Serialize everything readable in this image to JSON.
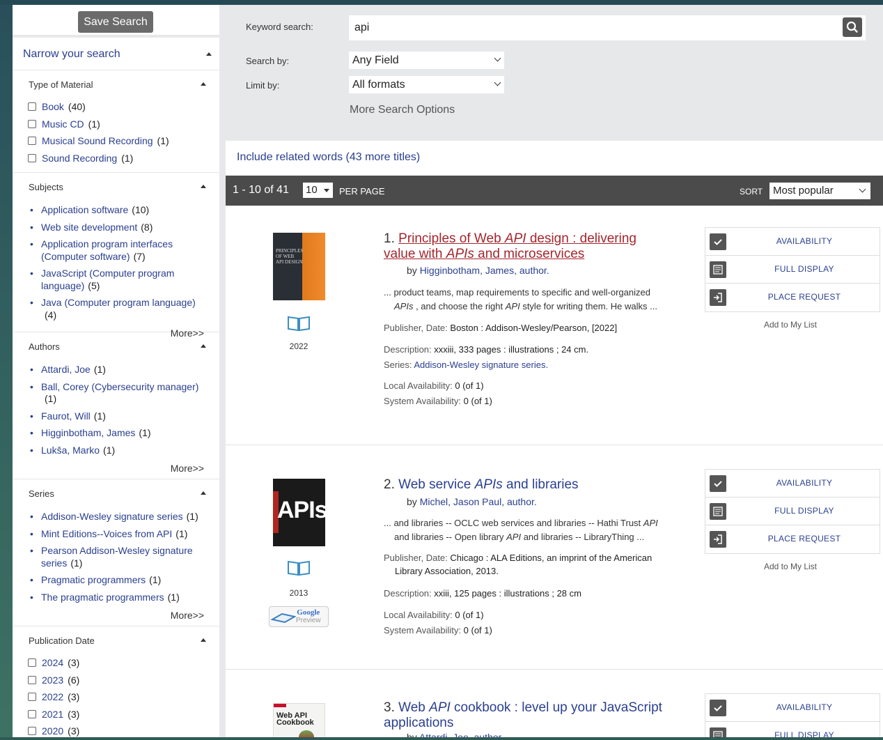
{
  "sidebar": {
    "save_search": "Save Search",
    "narrow_title": "Narrow your search",
    "type_of_material": {
      "title": "Type of Material",
      "items": [
        {
          "label": "Book",
          "count": "(40)"
        },
        {
          "label": "Music CD",
          "count": "(1)"
        },
        {
          "label": "Musical Sound Recording",
          "count": "(1)"
        },
        {
          "label": "Sound Recording",
          "count": "(1)"
        }
      ]
    },
    "subjects": {
      "title": "Subjects",
      "items": [
        {
          "label": "Application software",
          "count": "(10)"
        },
        {
          "label": "Web site development",
          "count": "(8)"
        },
        {
          "label": "Application program interfaces (Computer software)",
          "count": "(7)"
        },
        {
          "label": "JavaScript (Computer program language)",
          "count": "(5)"
        },
        {
          "label": "Java (Computer program language)",
          "count": "(4)"
        }
      ],
      "more": "More>>"
    },
    "authors": {
      "title": "Authors",
      "items": [
        {
          "label": "Attardi, Joe",
          "count": "(1)"
        },
        {
          "label": "Ball, Corey (Cybersecurity manager)",
          "count": "(1)"
        },
        {
          "label": "Faurot, Will",
          "count": "(1)"
        },
        {
          "label": "Higginbotham, James",
          "count": "(1)"
        },
        {
          "label": "Lukša, Marko",
          "count": "(1)"
        }
      ],
      "more": "More>>"
    },
    "series": {
      "title": "Series",
      "items": [
        {
          "label": "Addison-Wesley signature series",
          "count": "(1)"
        },
        {
          "label": "Mint Editions--Voices from API",
          "count": "(1)"
        },
        {
          "label": "Pearson Addison-Wesley signature series",
          "count": "(1)"
        },
        {
          "label": "Pragmatic programmers",
          "count": "(1)"
        },
        {
          "label": "The pragmatic programmers",
          "count": "(1)"
        }
      ],
      "more": "More>>"
    },
    "publication_date": {
      "title": "Publication Date",
      "items": [
        {
          "label": "2024",
          "count": "(3)"
        },
        {
          "label": "2023",
          "count": "(6)"
        },
        {
          "label": "2022",
          "count": "(3)"
        },
        {
          "label": "2021",
          "count": "(3)"
        },
        {
          "label": "2020",
          "count": "(3)"
        }
      ]
    }
  },
  "search": {
    "keyword_label": "Keyword search:",
    "keyword_value": "api",
    "search_by_label": "Search by:",
    "search_by_value": "Any Field",
    "limit_by_label": "Limit by:",
    "limit_by_value": "All formats",
    "more_options": "More Search Options"
  },
  "results": {
    "related": "Include related words (43 more titles)",
    "count": "1 - 10 of 41",
    "per_page_value": "10",
    "per_page_label": "PER PAGE",
    "sort_label": "SORT",
    "sort_value": "Most popular",
    "actions": {
      "availability": "AVAILABILITY",
      "full_display": "FULL DISPLAY",
      "place_request": "PLACE REQUEST",
      "add_to_list": "Add to My List"
    },
    "labels": {
      "publisher": "Publisher, Date:",
      "description": "Description:",
      "series": "Series:",
      "local": "Local Availability:",
      "system": "System Availability:",
      "by": "by"
    },
    "records": [
      {
        "num": "1.",
        "title_parts": [
          "Principles of Web ",
          "API",
          " design : delivering value with ",
          "APIs",
          " and microservices"
        ],
        "author": "Higginbotham, James, author.",
        "snippet_parts": [
          "... product teams, map requirements to specific and well-organized ",
          "APIs",
          " , and choose the right ",
          "API",
          " style for writing them. He walks ..."
        ],
        "year": "2022",
        "publisher": "Boston : Addison-Wesley/Pearson, [2022]",
        "description": "xxxiii, 333 pages : illustrations ; 24 cm.",
        "series": "Addison-Wesley signature series.",
        "local": "0 (of 1)",
        "system": "0 (of 1)",
        "cover_lines": [
          "PRINCIPLES",
          "OF WEB",
          "API DESIGN"
        ]
      },
      {
        "num": "2.",
        "title_parts": [
          "Web service ",
          "APIs",
          " and libraries"
        ],
        "author": "Michel, Jason Paul, author.",
        "snippet_parts": [
          "... and libraries -- OCLC web services and libraries -- Hathi Trust ",
          "API",
          " and libraries -- Open library ",
          "API",
          " and libraries -- LibraryThing ..."
        ],
        "year": "2013",
        "publisher": "Chicago : ALA Editions, an imprint of the American Library Association, 2013.",
        "description": "xxiii, 125 pages : illustrations ; 28 cm",
        "local": "0 (of 1)",
        "system": "0 (of 1)",
        "cover_lines": [
          "APIs"
        ],
        "google_preview": [
          "Google",
          "Preview"
        ]
      },
      {
        "num": "3.",
        "title_parts": [
          "Web ",
          "API",
          " cookbook : level up your JavaScript applications"
        ],
        "author": "Attardi, Joe, author.",
        "cover_lines": [
          "Web API",
          "Cookbook"
        ]
      }
    ]
  },
  "colors": {
    "link": "#2a3f8f",
    "title_visited": "#a3262e",
    "bar": "#4b4b4b",
    "button": "#6b6b6b"
  }
}
